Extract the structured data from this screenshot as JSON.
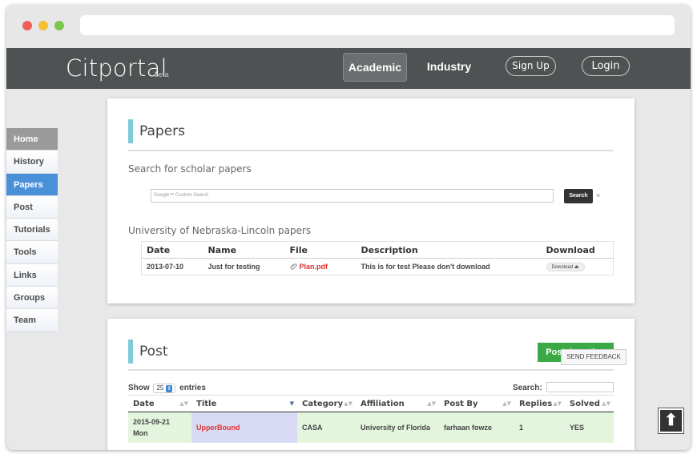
{
  "app": {
    "brand": "Citportal",
    "beta": "beta"
  },
  "topnav": {
    "academic": "Academic",
    "industry": "Industry",
    "signup": "Sign Up",
    "login": "Login"
  },
  "sidebar": {
    "items": [
      {
        "label": "Home"
      },
      {
        "label": "History"
      },
      {
        "label": "Papers"
      },
      {
        "label": "Post"
      },
      {
        "label": "Tutorials"
      },
      {
        "label": "Tools"
      },
      {
        "label": "Links"
      },
      {
        "label": "Groups"
      },
      {
        "label": "Team"
      }
    ]
  },
  "papers": {
    "title": "Papers",
    "search_label": "Search for scholar papers",
    "search_placeholder": "Google™ Custom Search",
    "search_button": "Search",
    "close_icon": "×",
    "section_label": "University of Nebraska-Lincoln papers",
    "columns": [
      "Date",
      "Name",
      "File",
      "Description",
      "Download"
    ],
    "rows": [
      {
        "date": "2013-07-10",
        "name": "Just for testing",
        "file": "Plan.pdf",
        "description": "This is for test Please don't download",
        "download": "Download"
      }
    ]
  },
  "post": {
    "title": "Post",
    "button": "Post Question",
    "show_prefix": "Show",
    "show_value": "25",
    "show_suffix": "entries",
    "search_label": "Search:",
    "columns": [
      "Date",
      "Title",
      "Category",
      "Affiliation",
      "Post By",
      "Replies",
      "Solved"
    ],
    "rows": [
      {
        "date": "2015-09-21",
        "day": "Mon",
        "title": "UpperBound",
        "category": "CASA",
        "affiliation": "University of Florida",
        "post_by": "farhaan fowze",
        "replies": "1",
        "solved": "YES"
      }
    ]
  },
  "feedback": "SEND FEEDBACK",
  "colors": {
    "accent": "#7ecad8",
    "active_nav": "#4a90d9",
    "post_button": "#3ba946",
    "link_red": "#dd3333"
  }
}
